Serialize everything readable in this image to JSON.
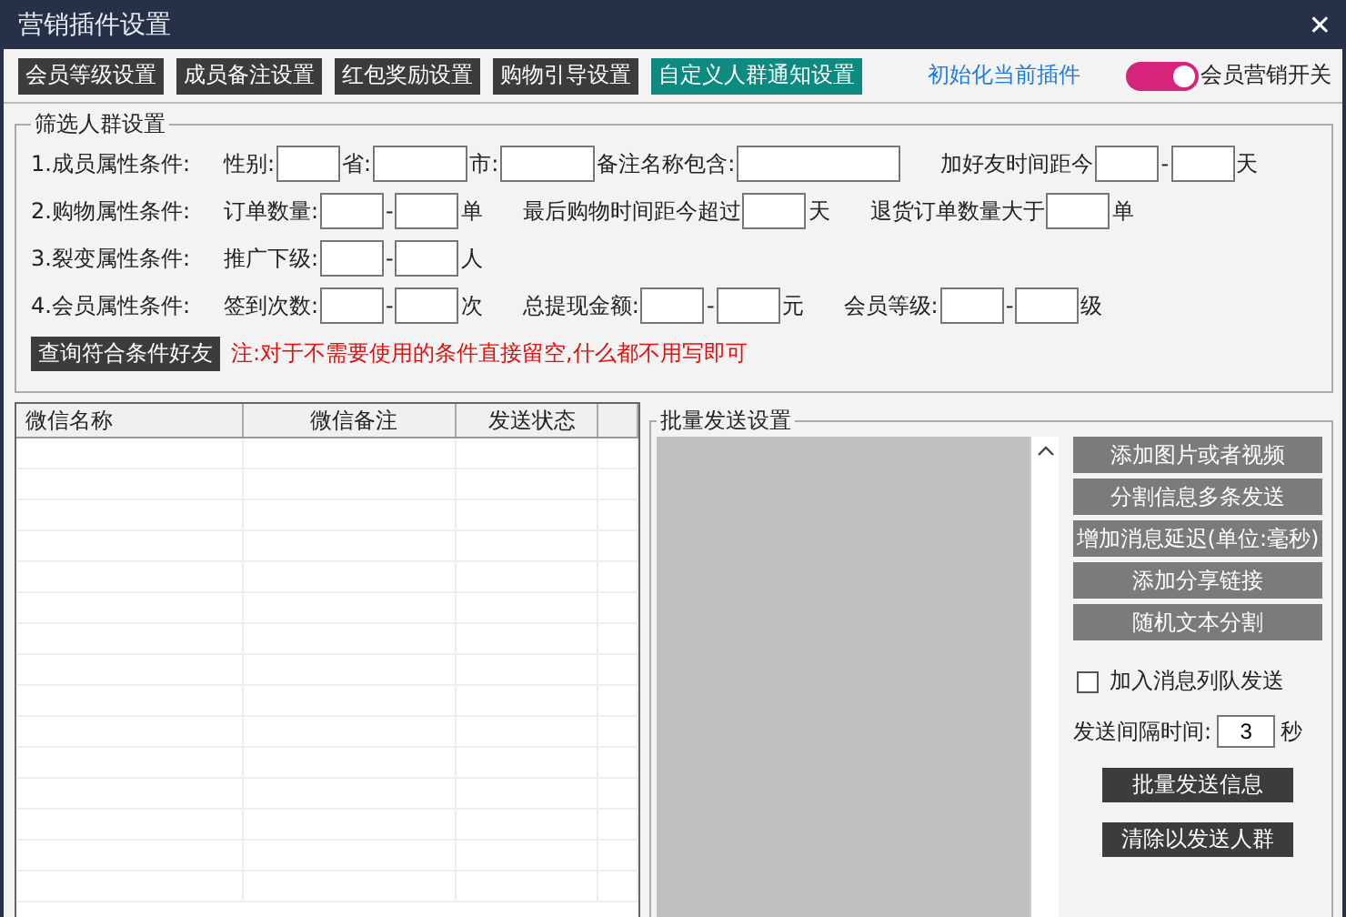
{
  "window": {
    "title": "营销插件设置",
    "close": "✕"
  },
  "toolbar": {
    "tabs": [
      {
        "label": "会员等级设置",
        "selected": false
      },
      {
        "label": "成员备注设置",
        "selected": false
      },
      {
        "label": "红包奖励设置",
        "selected": false
      },
      {
        "label": "购物引导设置",
        "selected": false
      },
      {
        "label": "自定义人群通知设置",
        "selected": true
      }
    ],
    "reset_link": "初始化当前插件",
    "switch": {
      "label": "会员营销开关",
      "on": true
    }
  },
  "filter": {
    "title": "筛选人群设置",
    "rows": [
      {
        "label": "1.成员属性条件:",
        "groups": [
          [
            {
              "kind": "text",
              "text": "性别:"
            },
            {
              "kind": "field"
            },
            {
              "kind": "text",
              "text": "省:"
            },
            {
              "kind": "midfield"
            },
            {
              "kind": "text",
              "text": "市:"
            },
            {
              "kind": "midfield"
            },
            {
              "kind": "text",
              "text": "备注名称包含:"
            },
            {
              "kind": "longfield"
            }
          ],
          [
            {
              "kind": "text",
              "text": "加好友时间距今"
            },
            {
              "kind": "field"
            },
            {
              "kind": "text",
              "text": "-"
            },
            {
              "kind": "field"
            },
            {
              "kind": "text",
              "text": "天"
            }
          ]
        ]
      },
      {
        "label": "2.购物属性条件:",
        "groups": [
          [
            {
              "kind": "text",
              "text": "订单数量:"
            },
            {
              "kind": "field"
            },
            {
              "kind": "text",
              "text": "-"
            },
            {
              "kind": "field"
            },
            {
              "kind": "text",
              "text": "单"
            }
          ],
          [
            {
              "kind": "text",
              "text": "最后购物时间距今超过"
            },
            {
              "kind": "field"
            },
            {
              "kind": "text",
              "text": "天"
            }
          ],
          [
            {
              "kind": "text",
              "text": "退货订单数量大于"
            },
            {
              "kind": "field"
            },
            {
              "kind": "text",
              "text": "单"
            }
          ]
        ]
      },
      {
        "label": "3.裂变属性条件:",
        "groups": [
          [
            {
              "kind": "text",
              "text": "推广下级:"
            },
            {
              "kind": "field"
            },
            {
              "kind": "text",
              "text": "-"
            },
            {
              "kind": "field"
            },
            {
              "kind": "text",
              "text": "人"
            }
          ]
        ]
      },
      {
        "label": "4.会员属性条件:",
        "groups": [
          [
            {
              "kind": "text",
              "text": "签到次数:"
            },
            {
              "kind": "field"
            },
            {
              "kind": "text",
              "text": "-"
            },
            {
              "kind": "field"
            },
            {
              "kind": "text",
              "text": "次"
            }
          ],
          [
            {
              "kind": "text",
              "text": "总提现金额:"
            },
            {
              "kind": "field"
            },
            {
              "kind": "text",
              "text": "-"
            },
            {
              "kind": "field"
            },
            {
              "kind": "text",
              "text": "元"
            }
          ],
          [
            {
              "kind": "text",
              "text": "会员等级:"
            },
            {
              "kind": "field"
            },
            {
              "kind": "text",
              "text": "-"
            },
            {
              "kind": "field"
            },
            {
              "kind": "text",
              "text": "级"
            }
          ]
        ]
      }
    ],
    "query_button": "查询符合条件好友",
    "note": "注:对于不需要使用的条件直接留空,什么都不用写即可"
  },
  "table": {
    "columns": [
      "微信名称",
      "微信备注",
      "发送状态"
    ]
  },
  "batch": {
    "title": "批量发送设置",
    "tool_buttons": [
      "添加图片或者视频",
      "分割信息多条发送",
      "增加消息延迟(单位:毫秒)",
      "添加分享链接",
      "随机文本分割"
    ],
    "queue_checkbox": {
      "label": "加入消息列队发送",
      "checked": false
    },
    "interval": {
      "label": "发送间隔时间:",
      "value": "3",
      "unit": "秒"
    },
    "action_buttons": [
      "批量发送信息",
      "清除以发送人群"
    ]
  }
}
